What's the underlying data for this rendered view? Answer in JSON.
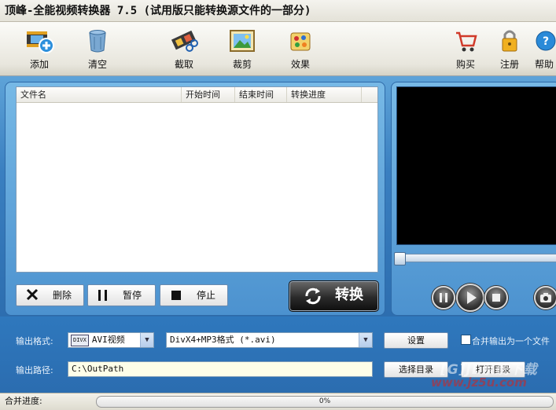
{
  "window": {
    "title": "顶峰-全能视频转换器 7.5 (试用版只能转换源文件的一部分)"
  },
  "toolbar": {
    "add": "添加",
    "clear": "清空",
    "capture": "截取",
    "crop": "裁剪",
    "effects": "效果",
    "buy": "购买",
    "register": "注册",
    "help": "帮助"
  },
  "filelist": {
    "columns": [
      "文件名",
      "开始时间",
      "结束时间",
      "转换进度"
    ]
  },
  "actions": {
    "delete": "删除",
    "pause": "暂停",
    "stop": "停止",
    "convert": "转换"
  },
  "output": {
    "format_label": "输出格式:",
    "format_value": "AVI视频",
    "format_badge": "DIVX",
    "codec_value": "DivX4+MP3格式 (*.avi)",
    "settings_button": "设置",
    "merge_label": "合并输出为一个文件",
    "merge_checked": false,
    "path_label": "输出路径:",
    "path_value": "C:\\OutPath",
    "choose_dir_button": "选择目录",
    "open_dir_button": "打开目录"
  },
  "status": {
    "label": "合并进度:",
    "progress_text": "0%",
    "progress": 0
  },
  "watermark": {
    "line1": "[G]JL系统下载",
    "line2": "www.jz5u.com"
  },
  "colors": {
    "accent_blue": "#3a7fc0",
    "panel_blue": "#4c92cf",
    "preview_bg": "#000000"
  }
}
